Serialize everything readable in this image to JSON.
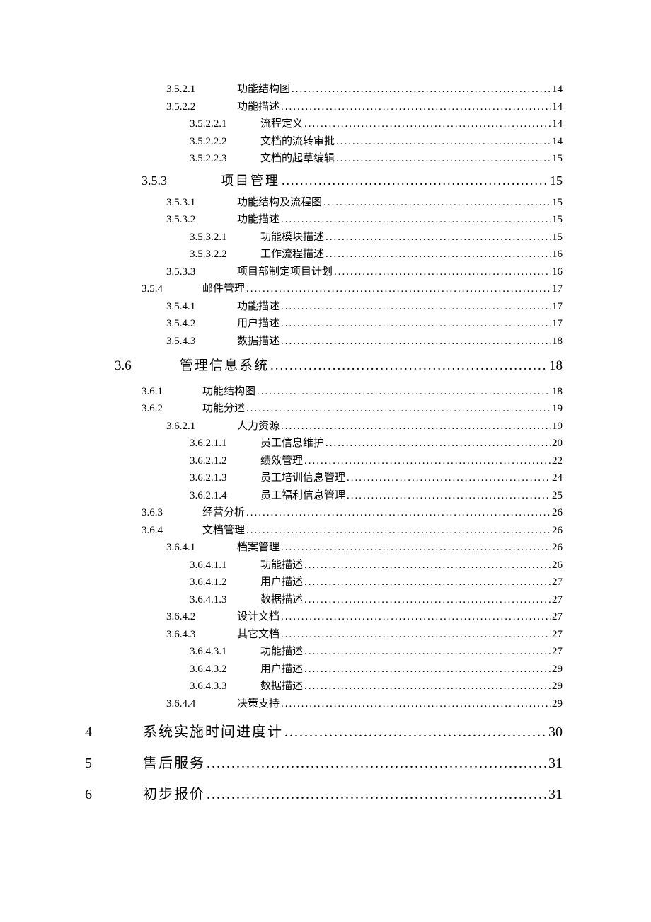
{
  "entries": [
    {
      "cls": "level-4",
      "num": "3.5.2.1",
      "title": "功能结构图",
      "page": "14"
    },
    {
      "cls": "level-4",
      "num": "3.5.2.2",
      "title": "功能描述",
      "page": "14"
    },
    {
      "cls": "level-5",
      "num": "3.5.2.2.1",
      "title": "流程定义",
      "page": "14"
    },
    {
      "cls": "level-5",
      "num": "3.5.2.2.2",
      "title": "文档的流转审批",
      "page": "14"
    },
    {
      "cls": "level-5",
      "num": "3.5.2.2.3",
      "title": "文档的起草编辑",
      "page": "15"
    },
    {
      "cls": "level-3h",
      "num": "3.5.3",
      "title": "项目管理",
      "page": "15"
    },
    {
      "cls": "level-4",
      "num": "3.5.3.1",
      "title": "功能结构及流程图",
      "page": "15"
    },
    {
      "cls": "level-4",
      "num": "3.5.3.2",
      "title": "功能描述",
      "page": "15"
    },
    {
      "cls": "level-5",
      "num": "3.5.3.2.1",
      "title": "功能模块描述",
      "page": "15"
    },
    {
      "cls": "level-5",
      "num": "3.5.3.2.2",
      "title": "工作流程描述",
      "page": "16"
    },
    {
      "cls": "level-4",
      "num": "3.5.3.3",
      "title": "项目部制定项目计划",
      "page": "16"
    },
    {
      "cls": "level-3",
      "num": "3.5.4",
      "title": "邮件管理",
      "page": "17"
    },
    {
      "cls": "level-4",
      "num": "3.5.4.1",
      "title": "功能描述",
      "page": "17"
    },
    {
      "cls": "level-4",
      "num": "3.5.4.2",
      "title": "用户描述",
      "page": "17"
    },
    {
      "cls": "level-4",
      "num": "3.5.4.3",
      "title": "数据描述",
      "page": "18"
    },
    {
      "cls": "level-2",
      "num": "3.6",
      "title": "管理信息系统",
      "page": "18"
    },
    {
      "cls": "level-3",
      "num": "3.6.1",
      "title": "功能结构图",
      "page": "18"
    },
    {
      "cls": "level-3",
      "num": "3.6.2",
      "title": "功能分述",
      "page": "19"
    },
    {
      "cls": "level-4",
      "num": "3.6.2.1",
      "title": "人力资源",
      "page": "19"
    },
    {
      "cls": "level-5",
      "num": "3.6.2.1.1",
      "title": "员工信息维护",
      "page": "20"
    },
    {
      "cls": "level-5",
      "num": "3.6.2.1.2",
      "title": "绩效管理",
      "page": "22"
    },
    {
      "cls": "level-5",
      "num": "3.6.2.1.3",
      "title": "员工培训信息管理",
      "page": "24"
    },
    {
      "cls": "level-5",
      "num": "3.6.2.1.4",
      "title": "员工福利信息管理",
      "page": "25"
    },
    {
      "cls": "level-3",
      "num": "3.6.3",
      "title": "经营分析",
      "page": "26"
    },
    {
      "cls": "level-3",
      "num": "3.6.4",
      "title": "文档管理",
      "page": "26"
    },
    {
      "cls": "level-4",
      "num": "3.6.4.1",
      "title": "档案管理",
      "page": "26"
    },
    {
      "cls": "level-5",
      "num": "3.6.4.1.1",
      "title": "功能描述",
      "page": "26"
    },
    {
      "cls": "level-5",
      "num": "3.6.4.1.2",
      "title": "用户描述",
      "page": "27"
    },
    {
      "cls": "level-5",
      "num": "3.6.4.1.3",
      "title": "数据描述",
      "page": "27"
    },
    {
      "cls": "level-4",
      "num": "3.6.4.2",
      "title": "设计文档",
      "page": "27"
    },
    {
      "cls": "level-4",
      "num": "3.6.4.3",
      "title": "其它文档",
      "page": "27"
    },
    {
      "cls": "level-5",
      "num": "3.6.4.3.1",
      "title": "功能描述",
      "page": "27"
    },
    {
      "cls": "level-5",
      "num": "3.6.4.3.2",
      "title": "用户描述",
      "page": "29"
    },
    {
      "cls": "level-5",
      "num": "3.6.4.3.3",
      "title": "数据描述",
      "page": "29"
    },
    {
      "cls": "level-4",
      "num": "3.6.4.4",
      "title": "决策支持",
      "page": "29"
    },
    {
      "cls": "level-1",
      "num": "4",
      "title": "系统实施时间进度计",
      "page": "30"
    },
    {
      "cls": "level-1",
      "num": "5",
      "title": "售后服务",
      "page": "31"
    },
    {
      "cls": "level-1",
      "num": "6",
      "title": "初步报价",
      "page": "31"
    }
  ]
}
